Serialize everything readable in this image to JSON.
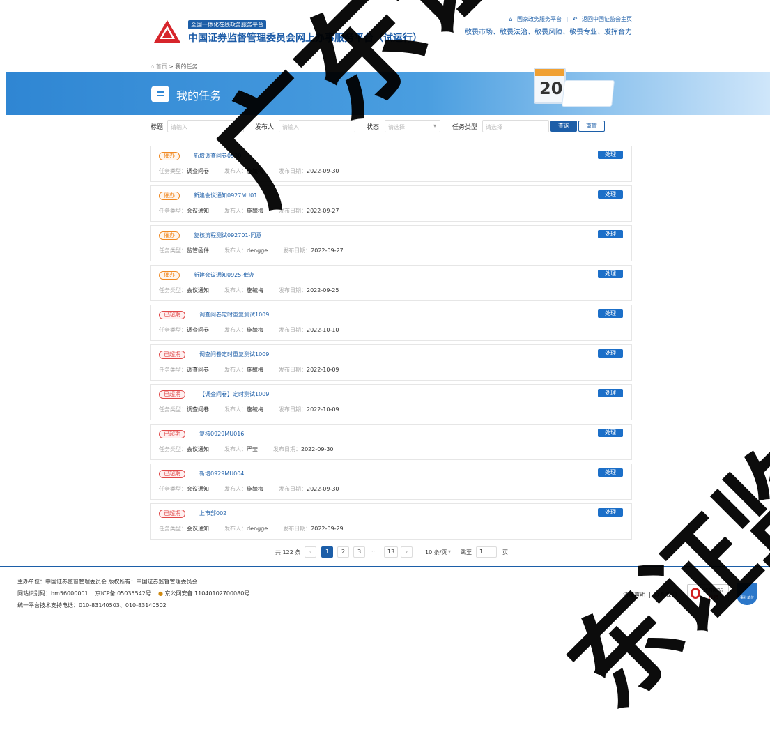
{
  "header": {
    "platform_tag": "全国一体化在线政务服务平台",
    "site_title": "中国证券监督管理委员会网上办事服务平台（试运行）",
    "links": [
      "国家政务服务平台",
      "返回中国证监会主页"
    ],
    "link_sep": "|",
    "slogan": "敬畏市场、敬畏法治、敬畏风险、敬畏专业、发挥合力"
  },
  "breadcrumb": {
    "home": "首页",
    "sep": ">",
    "current": "我的任务"
  },
  "banner": {
    "title": "我的任务",
    "calendar_number": "20"
  },
  "filter": {
    "title_label": "标题",
    "title_placeholder": "请输入",
    "publisher_label": "发布人",
    "publisher_placeholder": "请输入",
    "status_label": "状态",
    "status_placeholder": "请选择",
    "type_label": "任务类型",
    "type_placeholder": "请选择",
    "query_button": "查询",
    "reset_button": "重置"
  },
  "labels": {
    "type": "任务类型：",
    "publisher": "发布人：",
    "date": "发布日期：",
    "handle": "处理"
  },
  "tasks": [
    {
      "badge": "催办",
      "badge_kind": "urge",
      "title": "新增调查问卷0930",
      "type": "调查问卷",
      "publisher": "施毓梅",
      "date": "2022-09-30"
    },
    {
      "badge": "催办",
      "badge_kind": "urge",
      "title": "新建会议通知0927MU01",
      "type": "会议通知",
      "publisher": "施毓梅",
      "date": "2022-09-27"
    },
    {
      "badge": "催办",
      "badge_kind": "urge",
      "title": "复核流程测试092701-同意",
      "type": "监管函件",
      "publisher": "dengge",
      "date": "2022-09-27"
    },
    {
      "badge": "催办",
      "badge_kind": "urge",
      "title": "新建会议通知0925-催办",
      "type": "会议通知",
      "publisher": "施毓梅",
      "date": "2022-09-25"
    },
    {
      "badge": "已超期",
      "badge_kind": "over",
      "title": "调查问卷定时重复测试1009",
      "type": "调查问卷",
      "publisher": "施毓梅",
      "date": "2022-10-10"
    },
    {
      "badge": "已超期",
      "badge_kind": "over",
      "title": "调查问卷定时重复测试1009",
      "type": "调查问卷",
      "publisher": "施毓梅",
      "date": "2022-10-09"
    },
    {
      "badge": "已超期",
      "badge_kind": "over",
      "title": "【调查问卷】定时测试1009",
      "type": "调查问卷",
      "publisher": "施毓梅",
      "date": "2022-10-09"
    },
    {
      "badge": "已超期",
      "badge_kind": "over",
      "title": "复核0929MU016",
      "type": "会议通知",
      "publisher": "严莹",
      "date": "2022-09-30"
    },
    {
      "badge": "已超期",
      "badge_kind": "over",
      "title": "新增0929MU004",
      "type": "会议通知",
      "publisher": "施毓梅",
      "date": "2022-09-30"
    },
    {
      "badge": "已超期",
      "badge_kind": "over",
      "title": "上市部002",
      "type": "会议通知",
      "publisher": "dengge",
      "date": "2022-09-29"
    }
  ],
  "pager": {
    "total": "共 122 条",
    "prev": "‹",
    "pages": [
      "1",
      "2",
      "3"
    ],
    "ellipsis": "···",
    "last": "13",
    "next": "›",
    "page_size": "10 条/页",
    "jump_label": "跳至",
    "jump_value": "1",
    "page_unit": "页"
  },
  "footer": {
    "line1": "主办单位：中国证券监督管理委员会   版权所有：中国证券监督管理委员会",
    "line2a": "网站识别码：bm56000001",
    "line2b": "京ICP备 05035542号",
    "line2c": "京公网安备 11040102700080号",
    "line3": "统一平台技术支持电话：010-83140503、010-83140502",
    "legal": "法律声明",
    "sep": "|",
    "contact": "联系我们",
    "gov_badge_top": "政府网站",
    "gov_badge_bottom": "找错",
    "shield_text": "事业单位"
  },
  "watermark": {
    "text1": "广东证监局",
    "text2": "东证监局"
  },
  "colors": {
    "primary": "#1c5ea8",
    "urge": "#f08a24",
    "overdue": "#e04848"
  }
}
